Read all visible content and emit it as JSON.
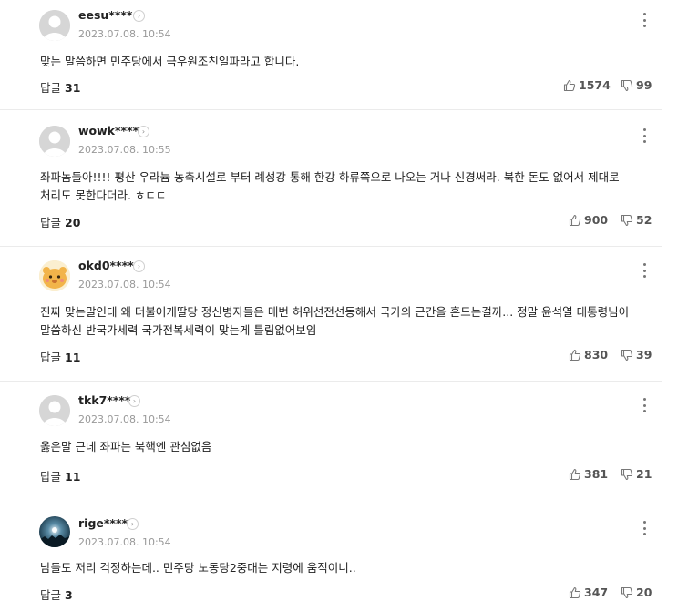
{
  "comments": [
    {
      "nickname": "eesu****",
      "date": "2023.07.08. 10:54",
      "text": "맞는 말씀하면 민주당에서 극우원조친일파라고 합니다.",
      "reply_label": "답글",
      "reply_count": "31",
      "likes": "1574",
      "dislikes": "99",
      "avatar": "default-avatar"
    },
    {
      "nickname": "wowk****",
      "date": "2023.07.08. 10:55",
      "text": "좌파놈들아!!!! 평산 우라늄 농축시설로 부터 례성강 통해 한강 하류쪽으로 나오는 거나 신경써라. 북한 돈도 없어서 제대로 처리도 못한다더라. ㅎㄷㄷ",
      "reply_label": "답글",
      "reply_count": "20",
      "likes": "900",
      "dislikes": "52",
      "avatar": "default-avatar"
    },
    {
      "nickname": "okd0****",
      "date": "2023.07.08. 10:54",
      "text": "진짜 맞는말인데 왜 더불어개딸당 정신병자들은 매번 허위선전선동해서 국가의 근간을 흔드는걸까... 정말 윤석열 대통령님이 말씀하신 반국가세력 국가전복세력이 맞는게 틀림없어보임",
      "reply_label": "답글",
      "reply_count": "11",
      "likes": "830",
      "dislikes": "39",
      "avatar": "character-avatar"
    },
    {
      "nickname": "tkk7****",
      "date": "2023.07.08. 10:54",
      "text": "옳은말 근데 좌파는 북핵엔 관심없음",
      "reply_label": "답글",
      "reply_count": "11",
      "likes": "381",
      "dislikes": "21",
      "avatar": "default-avatar"
    },
    {
      "nickname": "rige****",
      "date": "2023.07.08. 10:54",
      "text": "남들도 저리 걱정하는데.. 민주당 노동당2중대는 지령에 움직이니..",
      "reply_label": "답글",
      "reply_count": "3",
      "likes": "347",
      "dislikes": "20",
      "avatar": "photo-avatar"
    }
  ],
  "icons": {
    "profile_link": "chevron-right-icon",
    "menu": "kebab-menu-icon",
    "like": "thumbs-up-icon",
    "dislike": "thumbs-down-icon"
  },
  "colors": {
    "nickname": "#222222",
    "date": "#999999",
    "divider": "#ebebeb",
    "vote_count": "#555555"
  }
}
